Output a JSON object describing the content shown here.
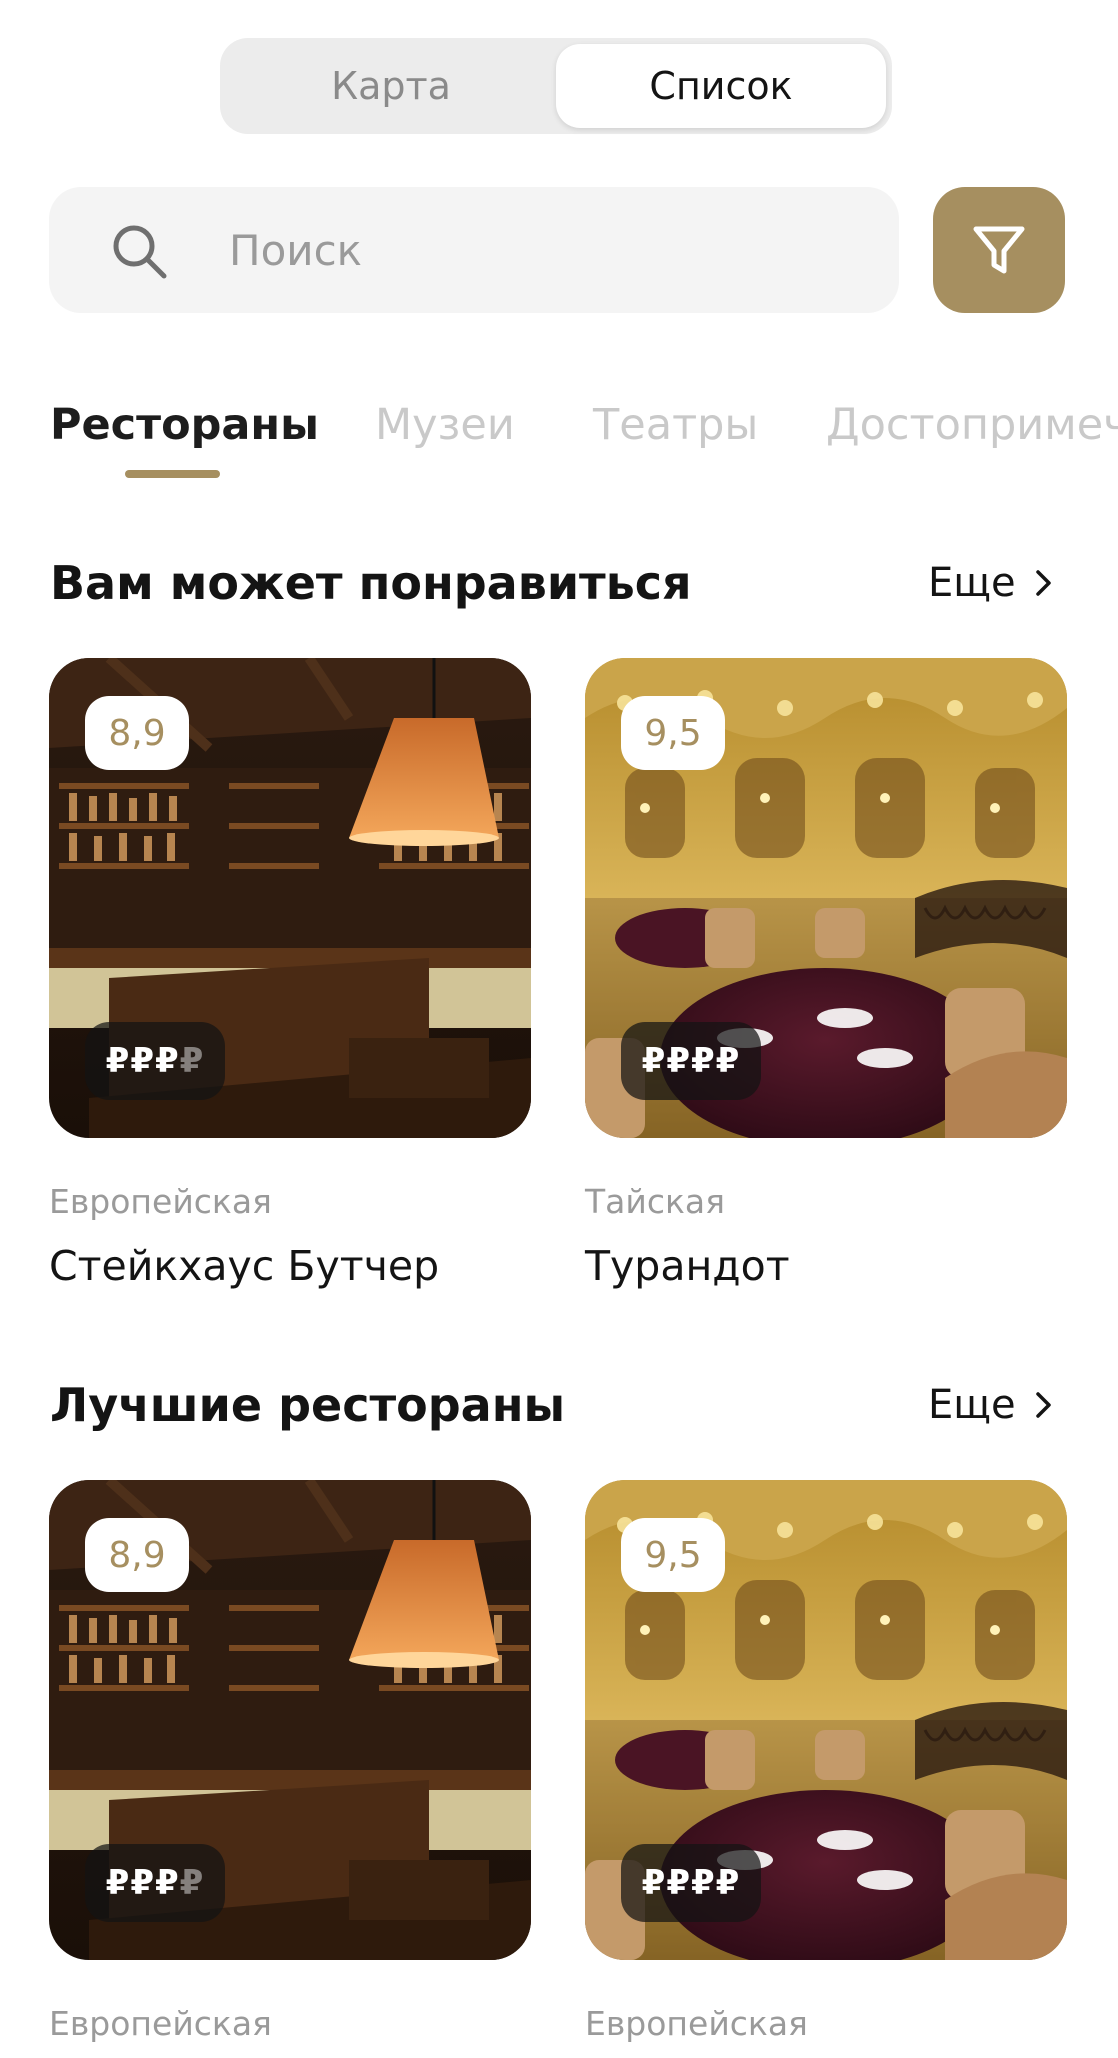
{
  "view_switch": {
    "map_label": "Карта",
    "list_label": "Список",
    "selected": "list"
  },
  "search": {
    "placeholder": "Поиск",
    "value": ""
  },
  "filter": {
    "icon": "filter-icon",
    "color": "#a68f60"
  },
  "categories": [
    "Рестораны",
    "Музеи",
    "Театры",
    "Достопримеч"
  ],
  "active_category": "Рестораны",
  "accent_color": "#a68f60",
  "sections": [
    {
      "title": "Вам может понравиться",
      "more_label": "Еще",
      "cards": [
        {
          "rating": "8,9",
          "price_active": "₽₽₽",
          "price_inactive": "₽",
          "cuisine": "Европейская",
          "name": "Стейкхаус Бутчер",
          "image": "steakhouse-bar-photo"
        },
        {
          "rating": "9,5",
          "price_active": "₽₽₽₽",
          "price_inactive": "",
          "cuisine": "Тайская",
          "name": "Турандот",
          "image": "baroque-hall-photo"
        }
      ]
    },
    {
      "title": "Лучшие рестораны",
      "more_label": "Еще",
      "cards": [
        {
          "rating": "8,9",
          "price_active": "₽₽₽",
          "price_inactive": "₽",
          "cuisine": "Европейская",
          "name": "",
          "image": "steakhouse-bar-photo"
        },
        {
          "rating": "9,5",
          "price_active": "₽₽₽₽",
          "price_inactive": "",
          "cuisine": "Европейская",
          "name": "",
          "image": "baroque-hall-photo"
        }
      ]
    }
  ]
}
